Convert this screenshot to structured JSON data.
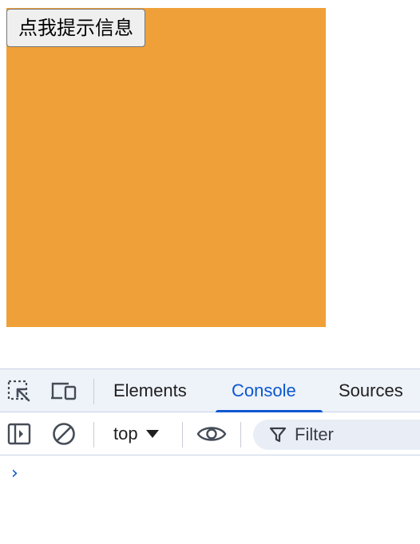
{
  "page": {
    "button_label": "点我提示信息",
    "box_color": "#f0a038"
  },
  "devtools": {
    "tabs": [
      {
        "label": "Elements",
        "active": false
      },
      {
        "label": "Console",
        "active": true
      },
      {
        "label": "Sources",
        "active": false
      }
    ],
    "toolbar": {
      "context": "top",
      "filter_placeholder": "Filter"
    },
    "console": {
      "prompt_glyph": "›"
    },
    "icons": {
      "inspect": "inspect-element-icon",
      "device": "device-toolbar-icon",
      "sidebar": "console-sidebar-icon",
      "clear": "clear-console-icon",
      "eye": "live-expression-icon",
      "filter": "filter-icon"
    },
    "accent_color": "#0b57d0"
  }
}
